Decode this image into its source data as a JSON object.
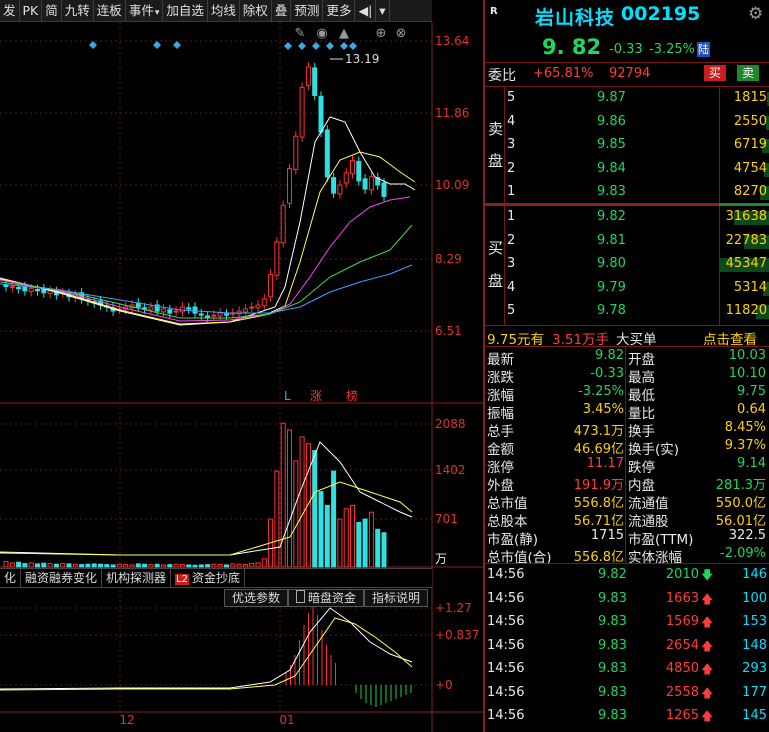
{
  "toolbar": {
    "items": [
      "发",
      "PK",
      "简",
      "九转",
      "连板",
      "事件",
      "加自选",
      "均线",
      "除权",
      "叠",
      "预测",
      "更多",
      "◀|"
    ]
  },
  "chart": {
    "price_ticks": [
      "13.64",
      "11.86",
      "10.09",
      "8.29",
      "6.51"
    ],
    "volume_ticks": [
      "2088",
      "1402",
      "701"
    ],
    "volume_unit": "万",
    "macd_ticks": [
      "+1.27",
      "+0.837",
      "+0"
    ],
    "high_label": "13.19",
    "x_labels": [
      "12",
      "01"
    ],
    "tags": {
      "l": "L",
      "zhang": "涨",
      "bang": "榜"
    },
    "colors": {
      "up": "#ff3030",
      "down": "#30e0e0",
      "ma5": "#ffffff",
      "ma10": "#ffff50",
      "ma20": "#ff40ff",
      "ma30": "#40e040",
      "ma60": "#40a0ff"
    }
  },
  "indicator_tabs": {
    "items": [
      "化",
      "融资融券变化",
      "机构探测器",
      "资金抄底"
    ],
    "badge": "L2"
  },
  "indicator_buttons": {
    "items": [
      "优选参数",
      "暗盘资金",
      "指标说明"
    ]
  },
  "stock": {
    "r_badge": "R",
    "name": "岩山科技",
    "code": "002195",
    "price": "9. 82",
    "change": "-0.33",
    "change_pct": "-3.25%",
    "lu": "陆"
  },
  "weibi": {
    "label": "委比",
    "pct": "+65.81%",
    "diff": "92794",
    "sell_btn": "买",
    "buy_btn": "卖"
  },
  "sell_label": [
    "卖",
    "盘"
  ],
  "buy_label": [
    "买",
    "盘"
  ],
  "sell_orders": [
    {
      "n": "5",
      "price": "9.87",
      "vol": "1815"
    },
    {
      "n": "4",
      "price": "9.86",
      "vol": "2550"
    },
    {
      "n": "3",
      "price": "9.85",
      "vol": "6719"
    },
    {
      "n": "2",
      "price": "9.84",
      "vol": "4754"
    },
    {
      "n": "1",
      "price": "9.83",
      "vol": "8270"
    }
  ],
  "buy_orders": [
    {
      "n": "1",
      "price": "9.82",
      "vol": "31638"
    },
    {
      "n": "2",
      "price": "9.81",
      "vol": "22783"
    },
    {
      "n": "3",
      "price": "9.80",
      "vol": "45347"
    },
    {
      "n": "4",
      "price": "9.79",
      "vol": "5314"
    },
    {
      "n": "5",
      "price": "9.78",
      "vol": "11820"
    }
  ],
  "big_order": {
    "price": "9.75元有",
    "vol": "3.51万手",
    "label": "大买单",
    "link": "点击查看"
  },
  "stats": [
    {
      "l1": "最新",
      "v1": "9.82",
      "l2": "开盘",
      "v2": "10.03"
    },
    {
      "l1": "涨跌",
      "v1": "-0.33",
      "l2": "最高",
      "v2": "10.10"
    },
    {
      "l1": "涨幅",
      "v1": "-3.25%",
      "l2": "最低",
      "v2": "9.75"
    },
    {
      "l1": "振幅",
      "v1": "3.45%",
      "l2": "量比",
      "v2": "0.64"
    },
    {
      "l1": "总手",
      "v1": "473.1万",
      "l2": "换手",
      "v2": "8.45%"
    },
    {
      "l1": "金额",
      "v1": "46.69亿",
      "l2": "换手(实)",
      "v2": "9.37%"
    },
    {
      "l1": "涨停",
      "v1": "11.17",
      "l2": "跌停",
      "v2": "9.14"
    },
    {
      "l1": "外盘",
      "v1": "191.9万",
      "l2": "内盘",
      "v2": "281.3万"
    },
    {
      "l1": "总市值",
      "v1": "556.8亿",
      "l2": "流通值",
      "v2": "550.0亿"
    },
    {
      "l1": "总股本",
      "v1": "56.71亿",
      "l2": "流通股",
      "v2": "56.01亿"
    },
    {
      "l1": "市盈(静)",
      "v1": "1715",
      "l2": "市盈(TTM)",
      "v2": "322.5"
    },
    {
      "l1": "总市值(合)",
      "v1": "556.8亿",
      "l2": "实体涨幅",
      "v2": "-2.09%"
    }
  ],
  "trades": [
    {
      "time": "14:56",
      "price": "9.82",
      "vol": "2010",
      "dir": "down",
      "cnt": "146"
    },
    {
      "time": "14:56",
      "price": "9.83",
      "vol": "1663",
      "dir": "up",
      "cnt": "100"
    },
    {
      "time": "14:56",
      "price": "9.83",
      "vol": "1569",
      "dir": "up",
      "cnt": "153"
    },
    {
      "time": "14:56",
      "price": "9.83",
      "vol": "2654",
      "dir": "up",
      "cnt": "148"
    },
    {
      "time": "14:56",
      "price": "9.83",
      "vol": "4850",
      "dir": "up",
      "cnt": "293"
    },
    {
      "time": "14:56",
      "price": "9.83",
      "vol": "2558",
      "dir": "up",
      "cnt": "177"
    },
    {
      "time": "14:56",
      "price": "9.83",
      "vol": "1265",
      "dir": "up",
      "cnt": "145"
    }
  ]
}
